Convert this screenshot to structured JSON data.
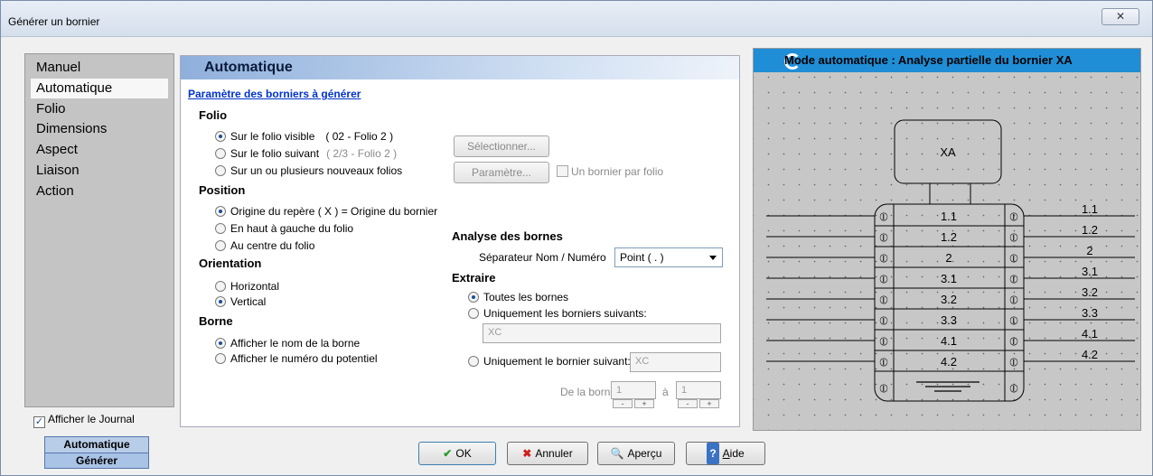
{
  "window": {
    "title": "Générer un bornier",
    "close_glyph": "✕"
  },
  "nav": {
    "items": [
      {
        "label": "Manuel",
        "selected": false
      },
      {
        "label": "Automatique",
        "selected": true
      },
      {
        "label": "Folio",
        "selected": false
      },
      {
        "label": "Dimensions",
        "selected": false
      },
      {
        "label": "Aspect",
        "selected": false
      },
      {
        "label": "Liaison",
        "selected": false
      },
      {
        "label": "Action",
        "selected": false
      }
    ],
    "journal_label": "Afficher le Journal",
    "journal_checked": true
  },
  "mode_tabs": {
    "top": "Automatique",
    "bottom": "Générer"
  },
  "panel": {
    "header": "Automatique",
    "subtitle": "Paramètre des borniers à générer",
    "folio": {
      "title": "Folio",
      "opt1": "Sur le folio visible",
      "opt1_info": "( 02 - Folio 2 )",
      "opt2": "Sur le folio suivant",
      "opt2_info": "( 2/3 - Folio 2 )",
      "opt3": "Sur un ou plusieurs nouveaux folios",
      "selected": 1,
      "select_button": "Sélectionner...",
      "param_button": "Paramètre...",
      "one_per_folio": "Un bornier par folio"
    },
    "position": {
      "title": "Position",
      "opt1": "Origine du repère ( X ) = Origine du bornier",
      "opt2": "En haut à gauche du folio",
      "opt3": "Au centre du folio",
      "selected": 1
    },
    "orientation": {
      "title": "Orientation",
      "opt1": "Horizontal",
      "opt2": "Vertical",
      "selected": 2
    },
    "borne": {
      "title": "Borne",
      "opt1": "Afficher le nom de la borne",
      "opt2": "Afficher le numéro du potentiel",
      "selected": 1
    },
    "analyse": {
      "title": "Analyse des bornes",
      "separator_label": "Séparateur Nom / Numéro",
      "separator_value": "Point ( . )"
    },
    "extraire": {
      "title": "Extraire",
      "opt1": "Toutes les bornes",
      "opt2": "Uniquement les borniers suivants:",
      "opt2_value": "XC",
      "opt3": "Uniquement le bornier suivant:",
      "opt3_value": "XC",
      "selected": 1,
      "range_label": "De la borne:",
      "range_from": "1",
      "range_sep": "à",
      "range_to": "1",
      "minus": "-",
      "plus": "+"
    }
  },
  "preview": {
    "title": "Mode automatique : Analyse partielle du bornier XA",
    "bornier_name": "XA",
    "terminals": [
      "1.1",
      "1.2",
      "2",
      "3.1",
      "3.2",
      "3.3",
      "4.1",
      "4.2"
    ],
    "symbol": "⦶"
  },
  "buttons": {
    "ok": "OK",
    "cancel": "Annuler",
    "preview": "Aperçu",
    "help_prefix": "A",
    "help_rest": "ide"
  },
  "colors": {
    "accent": "#1f8ed6",
    "link": "#0033cc"
  }
}
